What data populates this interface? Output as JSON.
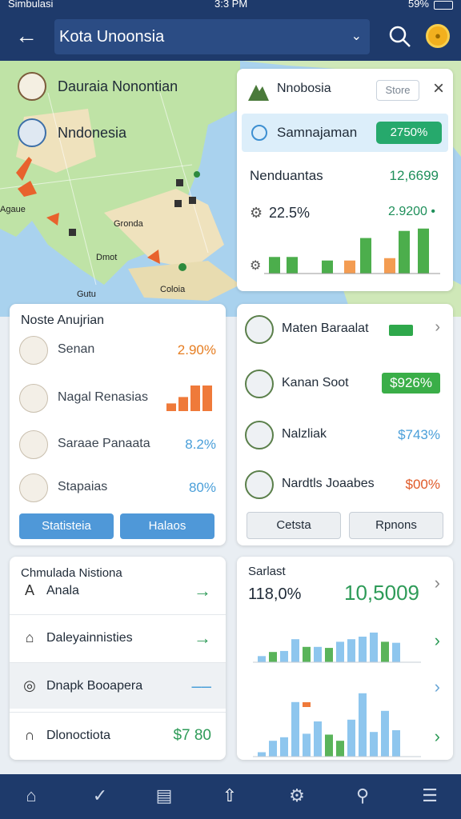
{
  "status": {
    "carrier": "Simbulasi",
    "time": "3:3 PM",
    "battery": "59%"
  },
  "header": {
    "city": "Kota Unoonsia"
  },
  "map": {
    "legend": [
      "Dauraia Nonontian",
      "Nndonesia"
    ],
    "labels": [
      "Gronda",
      "Dmot",
      "Coloia",
      "Agaue",
      "Gutu"
    ]
  },
  "info": {
    "title": "Nnobosia",
    "store_label": "Store",
    "selected": {
      "label": "Samnajaman",
      "value": "2750%"
    },
    "row_label": "Nenduantas",
    "row_value": "12,6699",
    "pct": "22.5%",
    "pct_value": "2.9200 •",
    "bars": [
      0.28,
      0.28,
      0.22,
      0.22,
      0.6,
      0.26,
      0.72,
      0.76
    ],
    "bar_colors": [
      "#4cae4c",
      "#4cae4c",
      "#4cae4c",
      "#f39c52",
      "#4cae4c",
      "#f39c52",
      "#4cae4c",
      "#4cae4c"
    ]
  },
  "left_list": {
    "title": "Noste Anujrian",
    "items": [
      {
        "label": "Senan",
        "value": "2.90%",
        "color": "#e67e22"
      },
      {
        "label": "Nagal Renasias",
        "value": "",
        "color": "#e67e22"
      },
      {
        "label": "Saraae Panaata",
        "value": "8.2%",
        "color": "#4a9fd9"
      },
      {
        "label": "Stapaias",
        "value": "80%",
        "color": "#4a9fd9"
      }
    ],
    "mini_bars": [
      0.3,
      0.55,
      1.0,
      1.0
    ],
    "buttons": [
      "Statisteia",
      "Halaos"
    ]
  },
  "right_list": {
    "items": [
      {
        "label": "Maten Baraalat",
        "value": "",
        "color": "#1e8f5a"
      },
      {
        "label": "Kanan Soot",
        "value": "$926%",
        "color": "#fff",
        "bg": "#3aae48"
      },
      {
        "label": "Nalzliak",
        "value": "$743%",
        "color": "#4a9fd9"
      },
      {
        "label": "Nardtls Joaabes",
        "value": "$00%",
        "color": "#e05a28"
      }
    ],
    "buttons": [
      "Cetsta",
      "Rpnons"
    ]
  },
  "nav_card": {
    "title": "Chmulada Nistiona",
    "rows": [
      {
        "icon": "A",
        "label": "Anala",
        "right": "→"
      },
      {
        "icon": "⌂",
        "label": "Daleyainnisties",
        "right": "→"
      },
      {
        "icon": "◎",
        "label": "Dnapk Booapera",
        "right": "‒‒"
      },
      {
        "icon": "∩",
        "label": "Dlonoctiota",
        "right": "$7 80"
      }
    ]
  },
  "chart_data": {
    "type": "bar",
    "title": "Sarlast",
    "values_top": [
      0.12,
      0.2,
      0.22,
      0.45,
      0.3,
      0.3,
      0.28,
      0.4,
      0.45,
      0.5,
      0.58,
      0.4,
      0.38
    ],
    "colors_top": [
      "#8ec6ee",
      "#5ab45a",
      "#8ec6ee",
      "#8ec6ee",
      "#5ab45a",
      "#8ec6ee",
      "#5ab45a",
      "#8ec6ee",
      "#8ec6ee",
      "#8ec6ee",
      "#8ec6ee",
      "#5ab45a",
      "#8ec6ee"
    ],
    "values_bottom": [
      0.05,
      0.18,
      0.22,
      0.62,
      0.26,
      0.4,
      0.25,
      0.18,
      0.42,
      0.72,
      0.28,
      0.52,
      0.3
    ],
    "colors_bottom": [
      "#8ec6ee",
      "#8ec6ee",
      "#8ec6ee",
      "#8ec6ee",
      "#8ec6ee",
      "#8ec6ee",
      "#5ab45a",
      "#5ab45a",
      "#8ec6ee",
      "#8ec6ee",
      "#8ec6ee",
      "#8ec6ee",
      "#8ec6ee"
    ],
    "value_left": "118,0%",
    "value_right": "10,5009"
  },
  "bottom_nav": [
    "home-icon",
    "check-circle-icon",
    "list-icon",
    "upload-icon",
    "gear-icon",
    "search-icon",
    "menu-icon"
  ]
}
